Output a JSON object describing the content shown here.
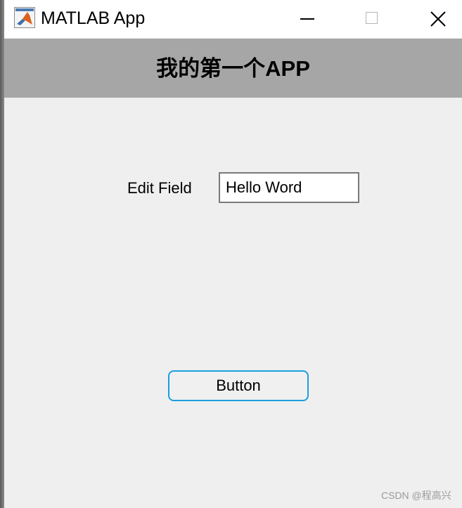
{
  "window": {
    "title": "MATLAB App",
    "icon": "matlab-logo-icon",
    "controls": [
      "minimize-icon",
      "maximize-icon",
      "close-icon"
    ]
  },
  "header": {
    "title": "我的第一个APP",
    "background": "#a6a6a6"
  },
  "form": {
    "field_label": "Edit Field",
    "field_value": "Hello Word"
  },
  "button": {
    "label": "Button",
    "border_color": "#1a9fe0"
  },
  "watermark": "CSDN @程高兴",
  "colors": {
    "window_background": "#efefef",
    "titlebar_background": "#ffffff"
  }
}
